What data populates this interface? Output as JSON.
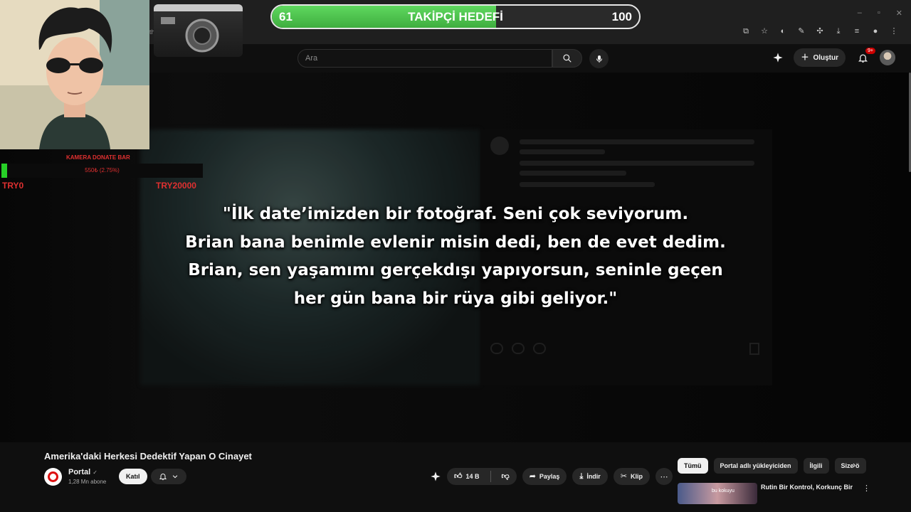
{
  "browser": {
    "tab_fragment": "th",
    "window_controls": [
      "–",
      "▫",
      "✕"
    ],
    "toolbar_icons": [
      "cast-icon",
      "star-icon",
      "extension-icon",
      "translate-icon",
      "puzzle-icon",
      "download-icon",
      "media-icon",
      "profile-icon",
      "menu-icon"
    ]
  },
  "header": {
    "search_placeholder": "Ara",
    "create_label": "Oluştur",
    "notification_badge": "9+"
  },
  "overlay": {
    "goal": {
      "current": "61",
      "title": "TAKİPÇİ HEDEFİ",
      "max": "100",
      "progress_fraction": 0.61
    },
    "donate": {
      "title": "KAMERA DONATE BAR",
      "percent_text": "550₺ (2.75%)",
      "progress_fraction": 0.0275,
      "min_label": "TRY0",
      "max_label": "TRY20000"
    }
  },
  "video": {
    "subtitle_lines": [
      "\"İlk date’imizden bir fotoğraf. Seni çok seviyorum.",
      "Brian bana benimle evlenir misin dedi, ben de evet dedim.",
      "Brian, sen yaşamımı gerçekdışı yapıyorsun, seninle geçen",
      "her gün bana bir rüya gibi geliyor.\""
    ]
  },
  "below": {
    "title": "Amerika'daki Herkesi Dedektif Yapan O Cinayet",
    "channel_name": "Portal",
    "channel_verified": "✓",
    "subscribers": "1,28 Mn abone",
    "join_label": "Katıl",
    "like_count": "14 B",
    "share_label": "Paylaş",
    "download_label": "İndir",
    "clip_label": "Klip",
    "chips": [
      "Tümü",
      "Portal adlı yükleyiciden",
      "İlgili",
      "Size ö"
    ],
    "rec_title": "Rutin Bir Kontrol, Korkunç Bir",
    "rec_thumb_text": "bu kokuyu"
  },
  "colors": {
    "accent_red": "#cc0000",
    "goal_green": "#4fc24f",
    "donate_red": "#e03030"
  }
}
